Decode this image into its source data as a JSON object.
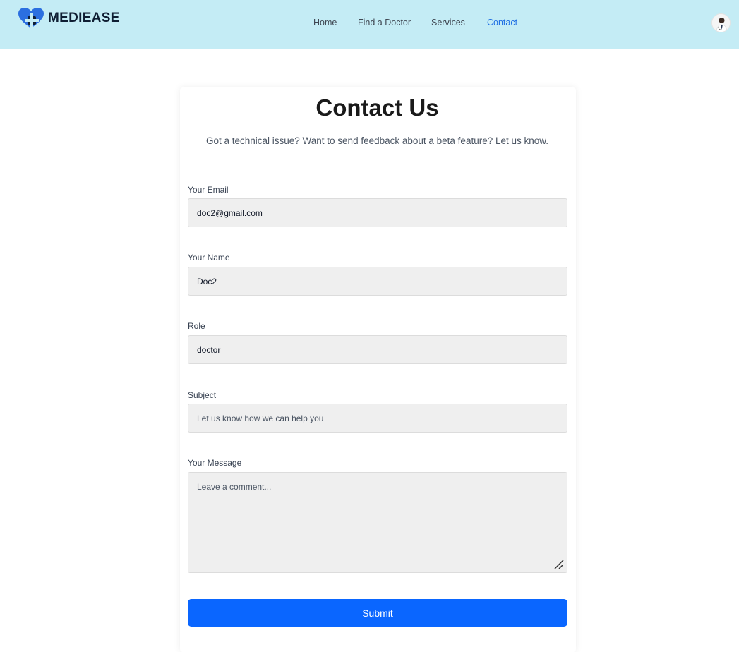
{
  "brand": {
    "name": "MEDIEASE",
    "logo_icon": "heart-plus-icon",
    "colors": {
      "dark": "#0f1e33",
      "blue": "#1f6fe3"
    }
  },
  "nav": {
    "items": [
      {
        "label": "Home"
      },
      {
        "label": "Find a Doctor"
      },
      {
        "label": "Services"
      },
      {
        "label": "Contact",
        "active": true
      }
    ]
  },
  "user": {
    "avatar_icon": "user-avatar-icon"
  },
  "contact": {
    "title": "Contact Us",
    "subtitle": "Got a technical issue? Want to send feedback about a beta feature? Let us know.",
    "fields": {
      "email": {
        "label": "Your Email",
        "value": "doc2@gmail.com"
      },
      "name": {
        "label": "Your Name",
        "value": "Doc2"
      },
      "role": {
        "label": "Role",
        "value": "doctor"
      },
      "subject": {
        "label": "Subject",
        "placeholder": "Let us know how we can help you"
      },
      "message": {
        "label": "Your Message",
        "placeholder": "Leave a comment..."
      }
    },
    "submit_label": "Submit"
  },
  "colors": {
    "header_bg": "#c4ecf5",
    "primary": "#0a66ff",
    "field_bg": "#efefef"
  }
}
